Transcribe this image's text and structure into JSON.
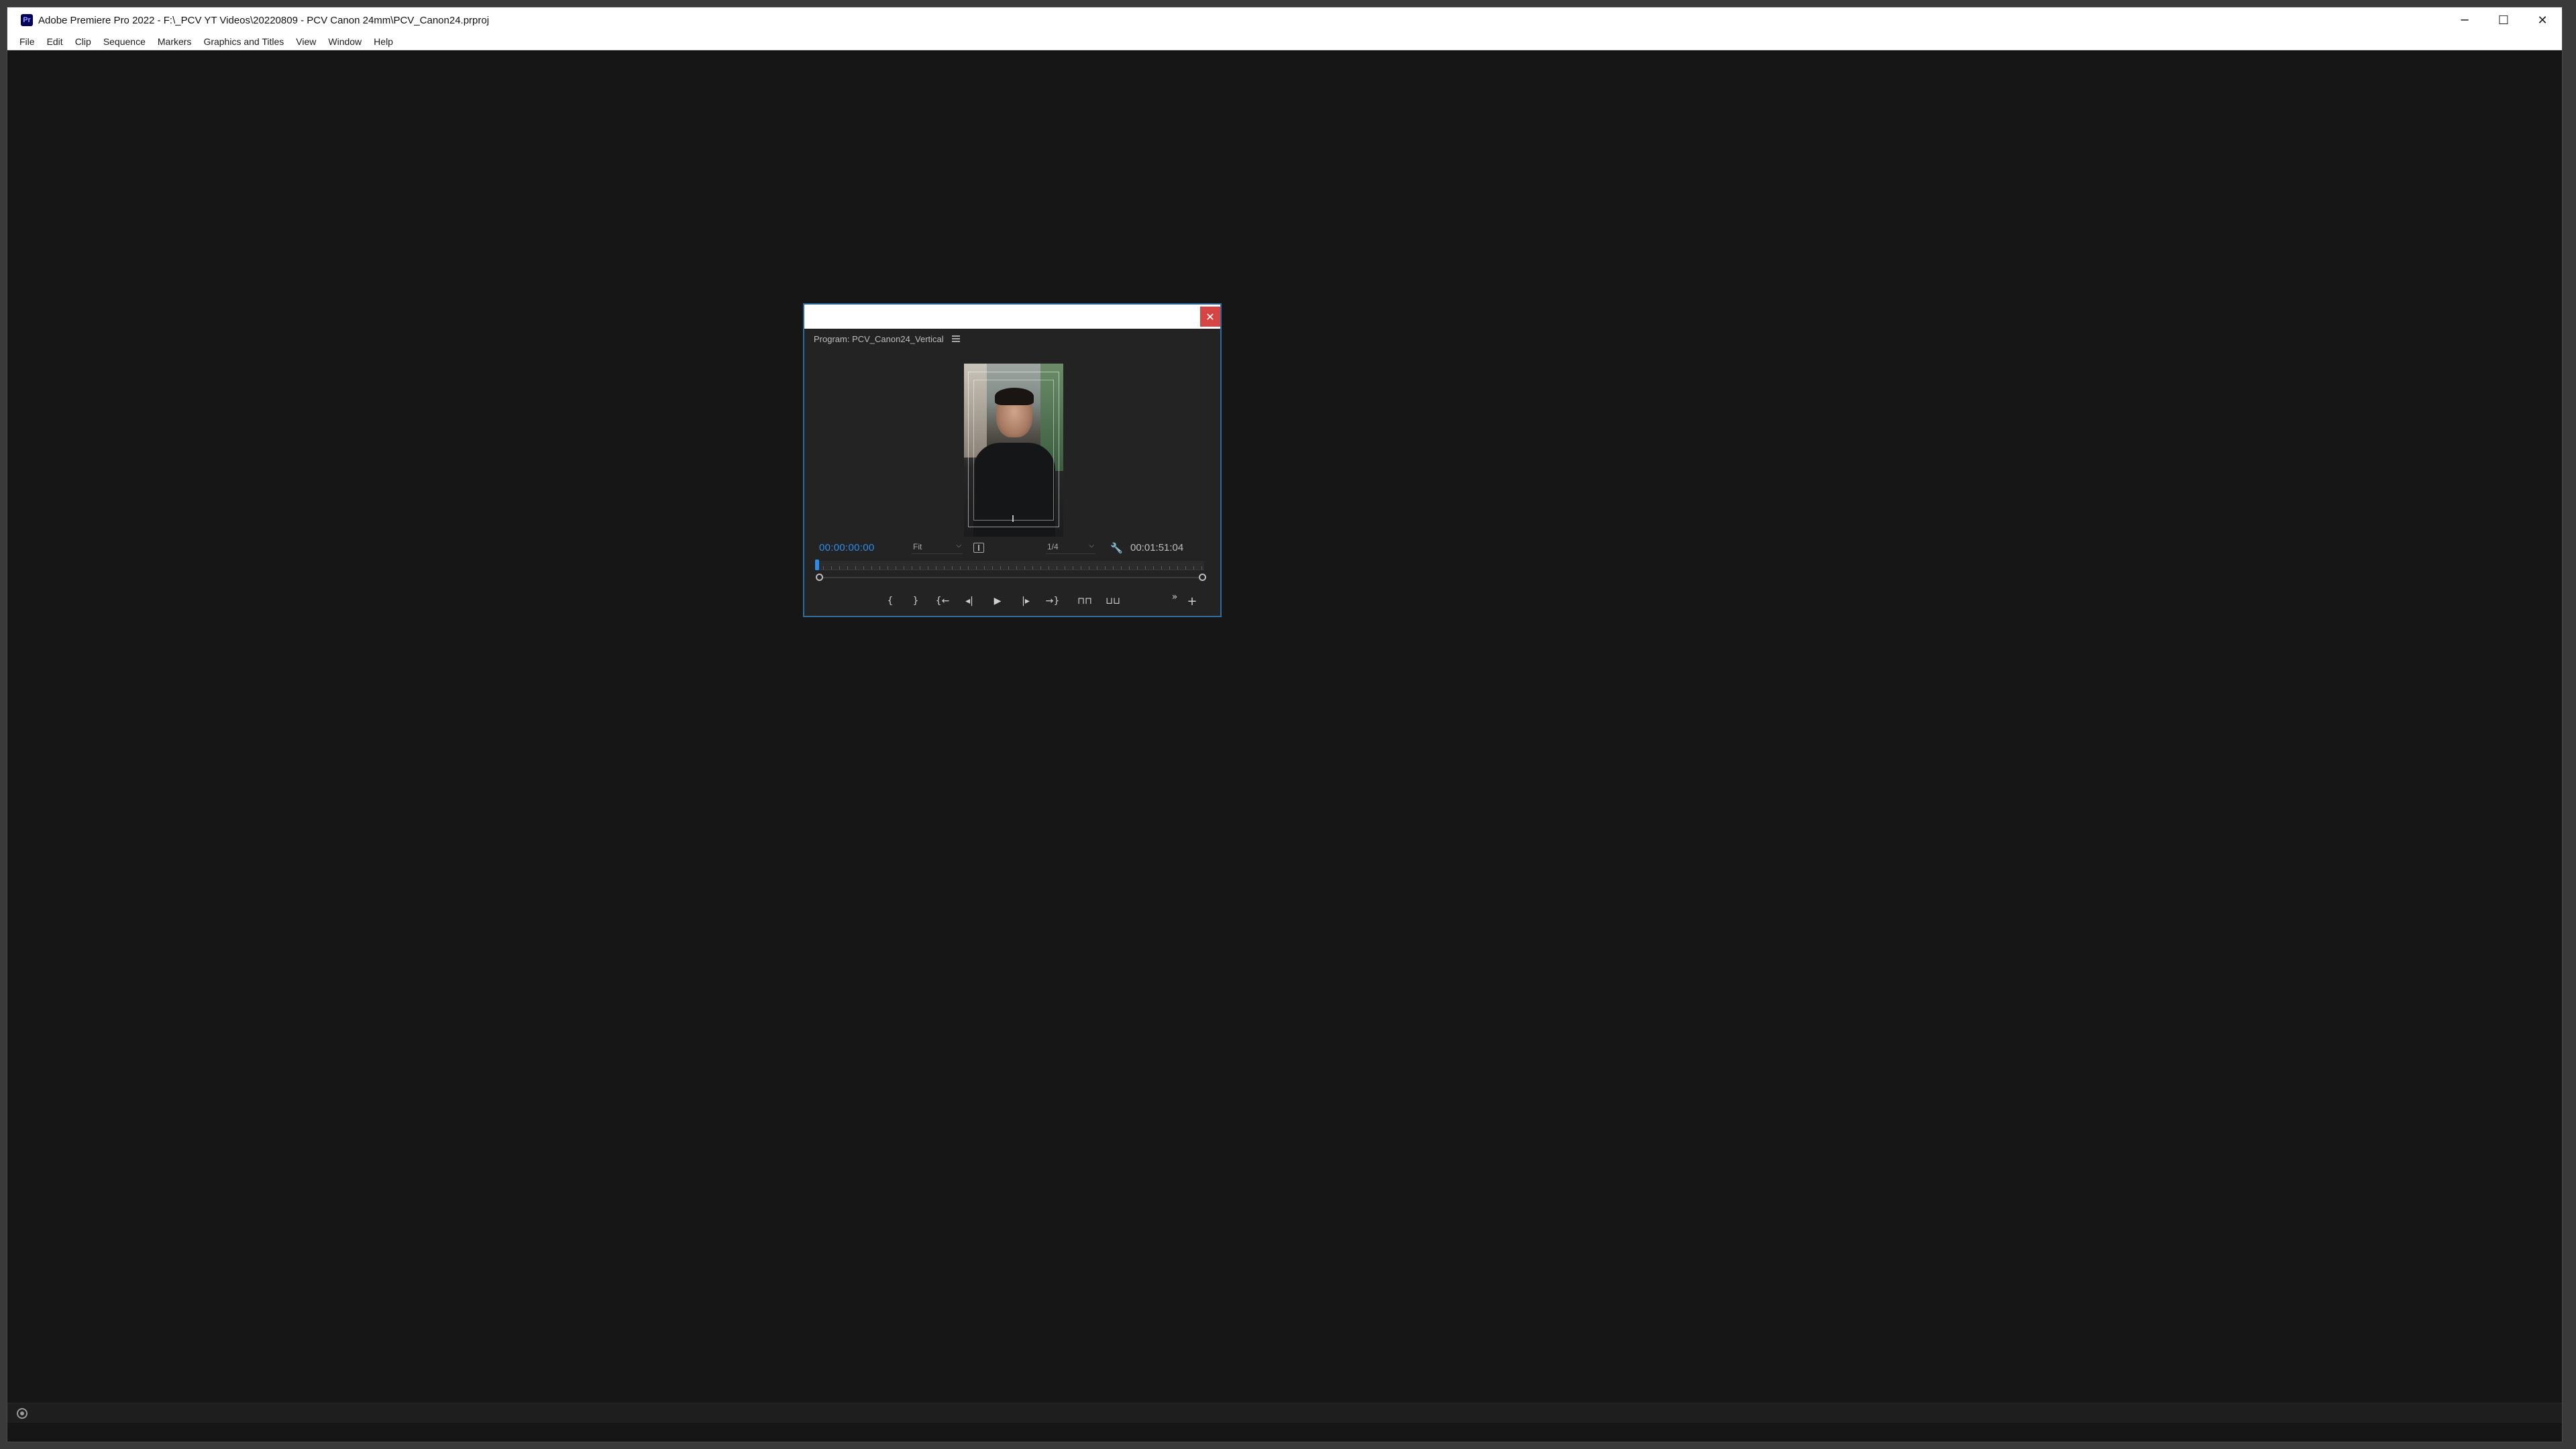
{
  "window": {
    "title": "Adobe Premiere Pro 2022 - F:\\_PCV YT Videos\\20220809 - PCV Canon 24mm\\PCV_Canon24.prproj",
    "app_icon_text": "Pr",
    "controls": {
      "minimize": "─",
      "maximize": "☐",
      "close": "✕"
    }
  },
  "menubar": {
    "items": [
      "File",
      "Edit",
      "Clip",
      "Sequence",
      "Markers",
      "Graphics and Titles",
      "View",
      "Window",
      "Help"
    ]
  },
  "program_monitor": {
    "panel_title": "Program: PCV_Canon24_Vertical",
    "close_glyph": "✕",
    "current_timecode": "00:00:00:00",
    "zoom_select": "Fit",
    "resolution_select": "1/4",
    "duration_timecode": "00:01:51:04",
    "chevron": "⌵",
    "wrench_glyph": "🔧",
    "transport": {
      "mark_in": "{",
      "mark_out": "}",
      "go_to_in": "{←",
      "step_back": "◂|",
      "play": "▶",
      "step_forward": "|▸",
      "go_to_out": "→}",
      "lift": "⊓⊓",
      "extract": "⊔⊔",
      "more": "»",
      "add": "+"
    }
  },
  "colors": {
    "accent_blue": "#2d8ceb",
    "panel_bg": "#232323",
    "workspace_bg": "#161616",
    "close_red": "#d64545"
  }
}
